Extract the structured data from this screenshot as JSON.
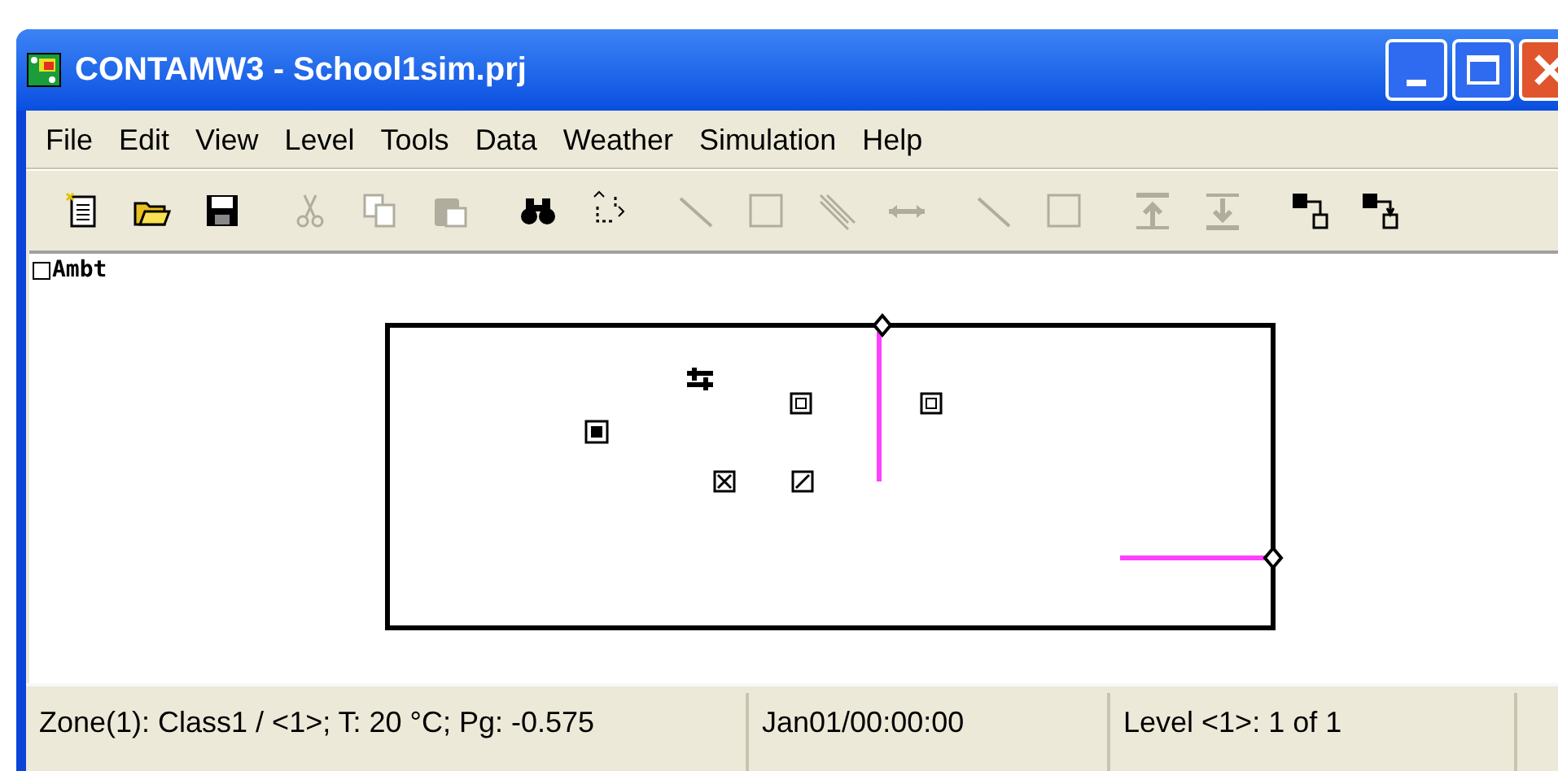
{
  "window": {
    "title": "CONTAMW3 - School1sim.prj"
  },
  "menu": [
    "File",
    "Edit",
    "View",
    "Level",
    "Tools",
    "Data",
    "Weather",
    "Simulation",
    "Help"
  ],
  "toolbar": [
    [
      {
        "kind": "new",
        "disabled": false
      },
      {
        "kind": "open",
        "disabled": false
      },
      {
        "kind": "save",
        "disabled": false
      }
    ],
    [
      {
        "kind": "cut",
        "disabled": true
      },
      {
        "kind": "copy",
        "disabled": true
      },
      {
        "kind": "paste",
        "disabled": true
      }
    ],
    [
      {
        "kind": "find",
        "disabled": false
      },
      {
        "kind": "connect",
        "disabled": false
      }
    ],
    [
      {
        "kind": "wall",
        "disabled": true
      },
      {
        "kind": "box",
        "disabled": true
      },
      {
        "kind": "duct",
        "disabled": true
      },
      {
        "kind": "arrow",
        "disabled": true
      }
    ],
    [
      {
        "kind": "wall",
        "disabled": true
      },
      {
        "kind": "box",
        "disabled": true
      }
    ],
    [
      {
        "kind": "up",
        "disabled": true
      },
      {
        "kind": "down",
        "disabled": true
      }
    ],
    [
      {
        "kind": "link-a",
        "disabled": false
      },
      {
        "kind": "link-b",
        "disabled": false
      }
    ]
  ],
  "canvas": {
    "ambient_label": "Ambt"
  },
  "status_bar": [
    "Zone(1): Class1 / <1>; T: 20 °C; Pg: -0.575",
    "Jan01/00:00:00",
    "Level <1>: 1 of 1"
  ]
}
